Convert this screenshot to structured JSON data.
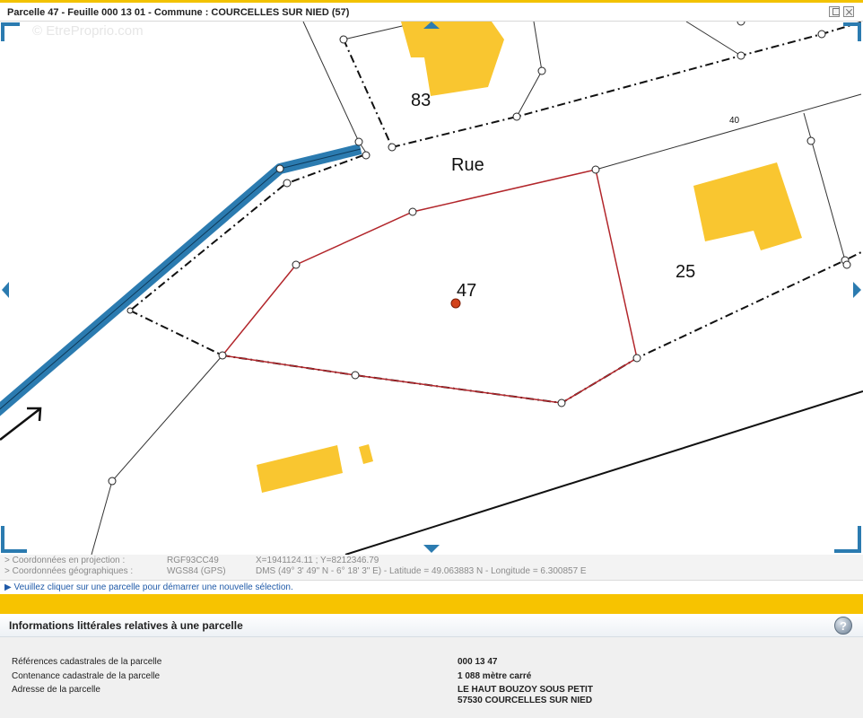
{
  "header": {
    "title": "Parcelle 47 - Feuille 000 13 01 - Commune : COURCELLES SUR NIED (57)"
  },
  "map": {
    "watermark": "© EtreProprio.com",
    "labels": {
      "p83": "83",
      "rue": "Rue",
      "p40": "40",
      "p47": "47",
      "p25": "25"
    },
    "colors": {
      "building": "#f9c630",
      "road": "#2b7bb0",
      "parcel_outline": "#b2262b",
      "nav_arrow": "#2b7bb0"
    }
  },
  "coordinates": {
    "projection": {
      "label": "> Coordonnées en projection :",
      "system": "RGF93CC49",
      "value": "X=1941124.11 ; Y=8212346.79"
    },
    "geographic": {
      "label": "> Coordonnées géographiques :",
      "system": "WGS84 (GPS)",
      "value": "DMS (49° 3' 49\" N - 6° 18' 3\" E) - Latitude = 49.063883 N - Longitude = 6.300857 E"
    }
  },
  "hint": "▶ Veuillez cliquer sur une parcelle pour démarrer une nouvelle sélection.",
  "panel": {
    "title": "Informations littérales relatives à une parcelle",
    "help_icon": "?",
    "rows": [
      {
        "label": "Références cadastrales de la parcelle",
        "value": "000 13 47"
      },
      {
        "label": "Contenance cadastrale de la parcelle",
        "value": "1 088 mètre carré"
      },
      {
        "label": "Adresse de la parcelle",
        "value_line1": "LE HAUT BOUZOY SOUS PETIT",
        "value_line2": "57530 COURCELLES SUR NIED"
      }
    ]
  }
}
